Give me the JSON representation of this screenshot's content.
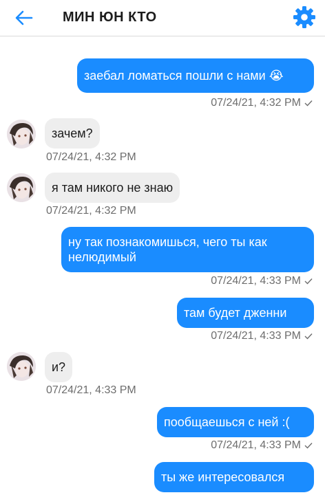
{
  "header": {
    "title": "МИН ЮН КТО",
    "back_icon": "back-arrow-icon",
    "settings_icon": "gear-icon"
  },
  "colors": {
    "accent": "#1a8cff",
    "incoming_bubble": "#eeeeee",
    "timestamp": "#6d6d6d"
  },
  "messages": [
    {
      "direction": "out",
      "text": "заебал ломаться пошли с нами 😭",
      "time": "07/24/21, 4:32 PM"
    },
    {
      "direction": "in",
      "text": "зачем?",
      "time": "07/24/21, 4:32 PM"
    },
    {
      "direction": "in",
      "text": "я там никого не знаю",
      "time": "07/24/21, 4:32 PM"
    },
    {
      "direction": "out",
      "text": "ну так познакомишься, чего ты как\nнелюдимый",
      "time": "07/24/21, 4:33 PM"
    },
    {
      "direction": "out",
      "text": "там будет дженни",
      "time": "07/24/21, 4:33 PM"
    },
    {
      "direction": "in",
      "text": "и?",
      "time": "07/24/21, 4:33 PM"
    },
    {
      "direction": "out",
      "text": "пообщаешься с ней :(",
      "time": "07/24/21, 4:33 PM"
    },
    {
      "direction": "out",
      "text": "ты же интересовался",
      "time": ""
    }
  ]
}
